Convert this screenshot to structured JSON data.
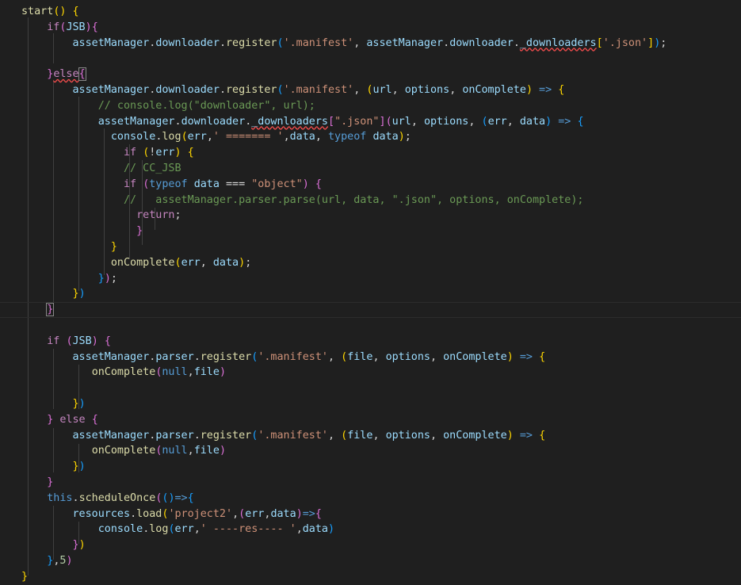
{
  "editor": {
    "lines": [
      [
        [
          "start",
          "f"
        ],
        [
          "() ",
          "b1"
        ],
        [
          "{",
          "b1"
        ]
      ],
      [
        [
          "    ",
          ""
        ],
        [
          "if",
          "k"
        ],
        [
          "(",
          "b2"
        ],
        [
          "JSB",
          "v"
        ],
        [
          ")",
          "b2"
        ],
        [
          "{",
          "b2"
        ]
      ],
      [
        [
          "        ",
          ""
        ],
        [
          "assetManager",
          "v"
        ],
        [
          ".",
          ""
        ],
        [
          "downloader",
          "v"
        ],
        [
          ".",
          ""
        ],
        [
          "register",
          "f"
        ],
        [
          "(",
          "b3"
        ],
        [
          "'.manifest'",
          "s"
        ],
        [
          ", ",
          ""
        ],
        [
          "assetManager",
          "v"
        ],
        [
          ".",
          ""
        ],
        [
          "downloader",
          "v"
        ],
        [
          ".",
          ""
        ],
        [
          "_downloaders",
          "v sq"
        ],
        [
          "[",
          "b1"
        ],
        [
          "'.json'",
          "s"
        ],
        [
          "]",
          "b1"
        ],
        [
          ")",
          "b3"
        ],
        [
          ";",
          ""
        ]
      ],
      [
        [
          "",
          ""
        ]
      ],
      [
        [
          "    ",
          ""
        ],
        [
          "}",
          "b2"
        ],
        [
          "else",
          "k sq"
        ],
        [
          "{",
          "b2 cursor-box"
        ]
      ],
      [
        [
          "        ",
          ""
        ],
        [
          "assetManager",
          "v"
        ],
        [
          ".",
          ""
        ],
        [
          "downloader",
          "v"
        ],
        [
          ".",
          ""
        ],
        [
          "register",
          "f"
        ],
        [
          "(",
          "b3"
        ],
        [
          "'.manifest'",
          "s"
        ],
        [
          ", ",
          ""
        ],
        [
          "(",
          "b1"
        ],
        [
          "url",
          "v"
        ],
        [
          ", ",
          ""
        ],
        [
          "options",
          "v"
        ],
        [
          ", ",
          ""
        ],
        [
          "onComplete",
          "v"
        ],
        [
          ")",
          "b1"
        ],
        [
          " => ",
          "kb"
        ],
        [
          "{",
          "b1"
        ]
      ],
      [
        [
          "            ",
          ""
        ],
        [
          "// console.log(\"downloader\", url);",
          "c"
        ]
      ],
      [
        [
          "            ",
          ""
        ],
        [
          "assetManager",
          "v"
        ],
        [
          ".",
          ""
        ],
        [
          "downloader",
          "v"
        ],
        [
          ".",
          ""
        ],
        [
          "_downloaders",
          "v sq"
        ],
        [
          "[",
          "b2"
        ],
        [
          "\".json\"",
          "s"
        ],
        [
          "]",
          "b2"
        ],
        [
          "(",
          "b2"
        ],
        [
          "url",
          "v"
        ],
        [
          ", ",
          ""
        ],
        [
          "options",
          "v"
        ],
        [
          ", ",
          ""
        ],
        [
          "(",
          "b3"
        ],
        [
          "err",
          "v"
        ],
        [
          ", ",
          ""
        ],
        [
          "data",
          "v"
        ],
        [
          ")",
          "b3"
        ],
        [
          " => ",
          "kb"
        ],
        [
          "{",
          "b3"
        ]
      ],
      [
        [
          "              ",
          ""
        ],
        [
          "console",
          "v"
        ],
        [
          ".",
          ""
        ],
        [
          "log",
          "f"
        ],
        [
          "(",
          "b1"
        ],
        [
          "err",
          "v"
        ],
        [
          ",",
          ""
        ],
        [
          "' ======= '",
          "s"
        ],
        [
          ",",
          ""
        ],
        [
          "data",
          "v"
        ],
        [
          ", ",
          ""
        ],
        [
          "typeof",
          "kb"
        ],
        [
          " ",
          ""
        ],
        [
          "data",
          "v"
        ],
        [
          ")",
          "b1"
        ],
        [
          ";",
          ""
        ]
      ],
      [
        [
          "                ",
          ""
        ],
        [
          "if",
          "k"
        ],
        [
          " ",
          ""
        ],
        [
          "(",
          "b1"
        ],
        [
          "!",
          ""
        ],
        [
          "err",
          "v"
        ],
        [
          ")",
          "b1"
        ],
        [
          " ",
          ""
        ],
        [
          "{",
          "b1"
        ]
      ],
      [
        [
          "                ",
          ""
        ],
        [
          "// CC_JSB",
          "c"
        ]
      ],
      [
        [
          "                ",
          ""
        ],
        [
          "if",
          "k"
        ],
        [
          " ",
          ""
        ],
        [
          "(",
          "b2"
        ],
        [
          "typeof",
          "kb"
        ],
        [
          " ",
          ""
        ],
        [
          "data",
          "v"
        ],
        [
          " === ",
          ""
        ],
        [
          "\"object\"",
          "s"
        ],
        [
          ")",
          "b2"
        ],
        [
          " ",
          ""
        ],
        [
          "{",
          "b2"
        ]
      ],
      [
        [
          "                ",
          ""
        ],
        [
          "//   assetManager.parser.parse(url, data, \".json\", options, onComplete);",
          "c"
        ]
      ],
      [
        [
          "                  ",
          ""
        ],
        [
          "return",
          "k"
        ],
        [
          ";",
          ""
        ]
      ],
      [
        [
          "                  ",
          ""
        ],
        [
          "}",
          "b2"
        ]
      ],
      [
        [
          "              ",
          ""
        ],
        [
          "}",
          "b1"
        ]
      ],
      [
        [
          "              ",
          ""
        ],
        [
          "onComplete",
          "f"
        ],
        [
          "(",
          "b1"
        ],
        [
          "err",
          "v"
        ],
        [
          ", ",
          ""
        ],
        [
          "data",
          "v"
        ],
        [
          ")",
          "b1"
        ],
        [
          ";",
          ""
        ]
      ],
      [
        [
          "            ",
          ""
        ],
        [
          "}",
          "b3"
        ],
        [
          ")",
          "b2"
        ],
        [
          ";",
          ""
        ]
      ],
      [
        [
          "        ",
          ""
        ],
        [
          "}",
          "b1"
        ],
        [
          ")",
          "b3"
        ]
      ],
      [
        [
          "    ",
          ""
        ],
        [
          "}",
          "b2 cursor-box"
        ]
      ],
      [
        [
          "",
          ""
        ]
      ],
      [
        [
          "    ",
          ""
        ],
        [
          "if",
          "k"
        ],
        [
          " ",
          ""
        ],
        [
          "(",
          "b2"
        ],
        [
          "JSB",
          "v"
        ],
        [
          ")",
          "b2"
        ],
        [
          " ",
          ""
        ],
        [
          "{",
          "b2"
        ]
      ],
      [
        [
          "        ",
          ""
        ],
        [
          "assetManager",
          "v"
        ],
        [
          ".",
          ""
        ],
        [
          "parser",
          "v"
        ],
        [
          ".",
          ""
        ],
        [
          "register",
          "f"
        ],
        [
          "(",
          "b3"
        ],
        [
          "'.manifest'",
          "s"
        ],
        [
          ", ",
          ""
        ],
        [
          "(",
          "b1"
        ],
        [
          "file",
          "v"
        ],
        [
          ", ",
          ""
        ],
        [
          "options",
          "v"
        ],
        [
          ", ",
          ""
        ],
        [
          "onComplete",
          "v"
        ],
        [
          ")",
          "b1"
        ],
        [
          " => ",
          "kb"
        ],
        [
          "{",
          "b1"
        ]
      ],
      [
        [
          "           ",
          ""
        ],
        [
          "onComplete",
          "f"
        ],
        [
          "(",
          "b2"
        ],
        [
          "null",
          "kb"
        ],
        [
          ",",
          ""
        ],
        [
          "file",
          "v"
        ],
        [
          ")",
          "b2"
        ]
      ],
      [
        [
          "",
          ""
        ]
      ],
      [
        [
          "        ",
          ""
        ],
        [
          "}",
          "b1"
        ],
        [
          ")",
          "b3"
        ]
      ],
      [
        [
          "    ",
          ""
        ],
        [
          "}",
          "b2"
        ],
        [
          " ",
          ""
        ],
        [
          "else",
          "k"
        ],
        [
          " ",
          ""
        ],
        [
          "{",
          "b2"
        ]
      ],
      [
        [
          "        ",
          ""
        ],
        [
          "assetManager",
          "v"
        ],
        [
          ".",
          ""
        ],
        [
          "parser",
          "v"
        ],
        [
          ".",
          ""
        ],
        [
          "register",
          "f"
        ],
        [
          "(",
          "b3"
        ],
        [
          "'.manifest'",
          "s"
        ],
        [
          ", ",
          ""
        ],
        [
          "(",
          "b1"
        ],
        [
          "file",
          "v"
        ],
        [
          ", ",
          ""
        ],
        [
          "options",
          "v"
        ],
        [
          ", ",
          ""
        ],
        [
          "onComplete",
          "v"
        ],
        [
          ")",
          "b1"
        ],
        [
          " => ",
          "kb"
        ],
        [
          "{",
          "b1"
        ]
      ],
      [
        [
          "           ",
          ""
        ],
        [
          "onComplete",
          "f"
        ],
        [
          "(",
          "b2"
        ],
        [
          "null",
          "kb"
        ],
        [
          ",",
          ""
        ],
        [
          "file",
          "v"
        ],
        [
          ")",
          "b2"
        ]
      ],
      [
        [
          "        ",
          ""
        ],
        [
          "}",
          "b1"
        ],
        [
          ")",
          "b3"
        ]
      ],
      [
        [
          "    ",
          ""
        ],
        [
          "}",
          "b2"
        ]
      ],
      [
        [
          "    ",
          ""
        ],
        [
          "this",
          "kb"
        ],
        [
          ".",
          ""
        ],
        [
          "scheduleOnce",
          "f"
        ],
        [
          "(",
          "b2"
        ],
        [
          "(",
          "b3"
        ],
        [
          ")",
          "b3"
        ],
        [
          "=>",
          "kb"
        ],
        [
          "{",
          "b3"
        ]
      ],
      [
        [
          "        ",
          ""
        ],
        [
          "resources",
          "v"
        ],
        [
          ".",
          ""
        ],
        [
          "load",
          "f"
        ],
        [
          "(",
          "b1"
        ],
        [
          "'project2'",
          "s"
        ],
        [
          ",",
          ""
        ],
        [
          "(",
          "b2"
        ],
        [
          "err",
          "v"
        ],
        [
          ",",
          ""
        ],
        [
          "data",
          "v"
        ],
        [
          ")",
          "b2"
        ],
        [
          "=>",
          "kb"
        ],
        [
          "{",
          "b2"
        ]
      ],
      [
        [
          "            ",
          ""
        ],
        [
          "console",
          "v"
        ],
        [
          ".",
          ""
        ],
        [
          "log",
          "f"
        ],
        [
          "(",
          "b3"
        ],
        [
          "err",
          "v"
        ],
        [
          ",",
          ""
        ],
        [
          "' ----res---- '",
          "s"
        ],
        [
          ",",
          ""
        ],
        [
          "data",
          "v"
        ],
        [
          ")",
          "b3"
        ]
      ],
      [
        [
          "        ",
          ""
        ],
        [
          "}",
          "b2"
        ],
        [
          ")",
          "b1"
        ]
      ],
      [
        [
          "    ",
          ""
        ],
        [
          "}",
          "b3"
        ],
        [
          ",",
          ""
        ],
        [
          "5",
          "n"
        ],
        [
          ")",
          "b2"
        ]
      ],
      [
        [
          "",
          ""
        ],
        [
          "}",
          "b1"
        ]
      ]
    ]
  }
}
